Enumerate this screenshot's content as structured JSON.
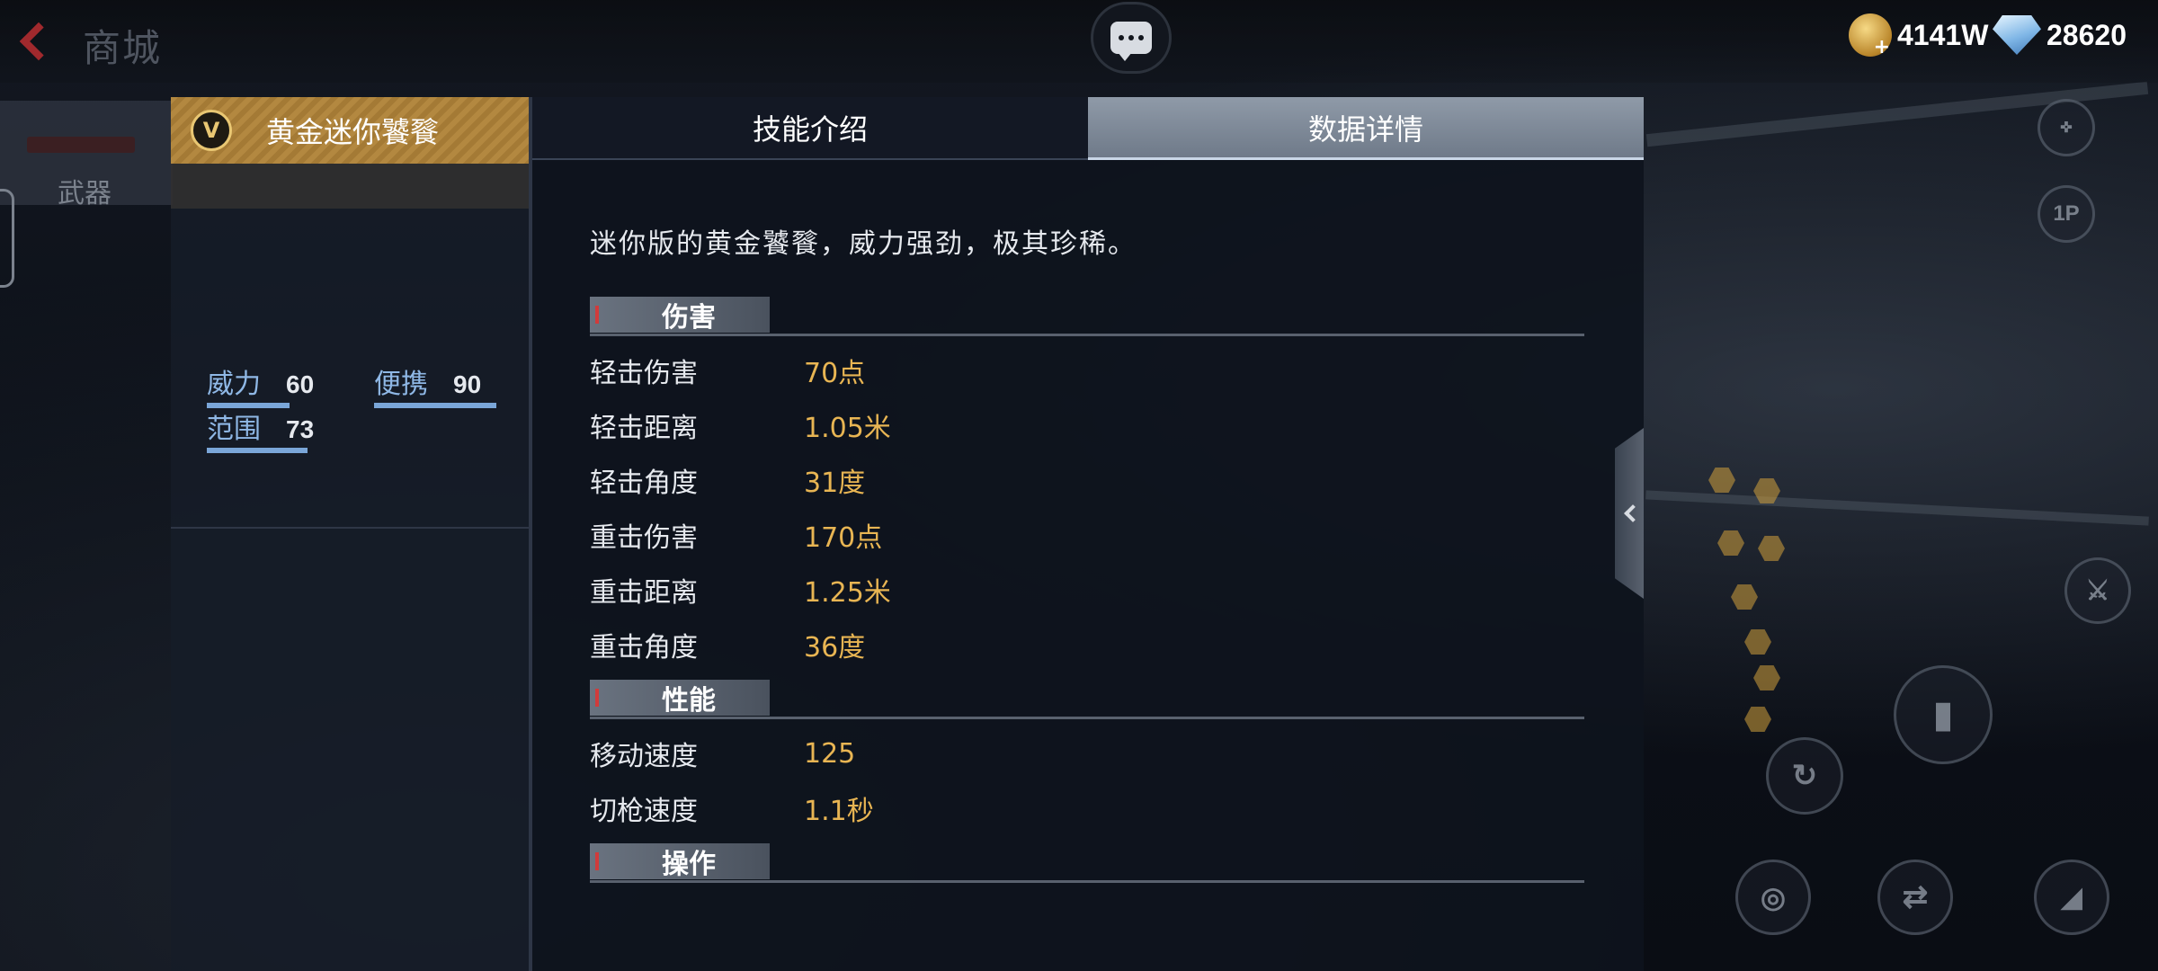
{
  "header": {
    "title": "商城",
    "gold_amount": "4141W",
    "diamond_amount": "28620"
  },
  "sidebar": {
    "tab_label": "武器"
  },
  "weapon": {
    "name": "黄金迷你饕餮",
    "badge": "V",
    "stats": [
      {
        "label": "威力",
        "value": "60",
        "level": 60
      },
      {
        "label": "便携",
        "value": "90",
        "level": 90
      },
      {
        "label": "范围",
        "value": "73",
        "level": 73
      }
    ]
  },
  "tabs": [
    {
      "label": "技能介绍",
      "active": false
    },
    {
      "label": "数据详情",
      "active": true
    }
  ],
  "detail": {
    "description": "迷你版的黄金饕餮，威力强劲，极其珍稀。",
    "sections": [
      {
        "title": "伤害",
        "rows": [
          {
            "key": "轻击伤害",
            "value": "70点"
          },
          {
            "key": "轻击距离",
            "value": "1.05米"
          },
          {
            "key": "轻击角度",
            "value": "31度"
          },
          {
            "key": "重击伤害",
            "value": "170点"
          },
          {
            "key": "重击距离",
            "value": "1.25米"
          },
          {
            "key": "重击角度",
            "value": "36度"
          }
        ]
      },
      {
        "title": "性能",
        "rows": [
          {
            "key": "移动速度",
            "value": "125"
          },
          {
            "key": "切枪速度",
            "value": "1.1秒"
          }
        ]
      },
      {
        "title": "操作",
        "rows": []
      }
    ]
  },
  "hud": {
    "view_toggle_label": "1P"
  },
  "colors": {
    "accent_gold": "#e8b553",
    "header_gold": "#b38840",
    "stat_blue": "#8fb8e6",
    "back_red": "#a0292d"
  }
}
